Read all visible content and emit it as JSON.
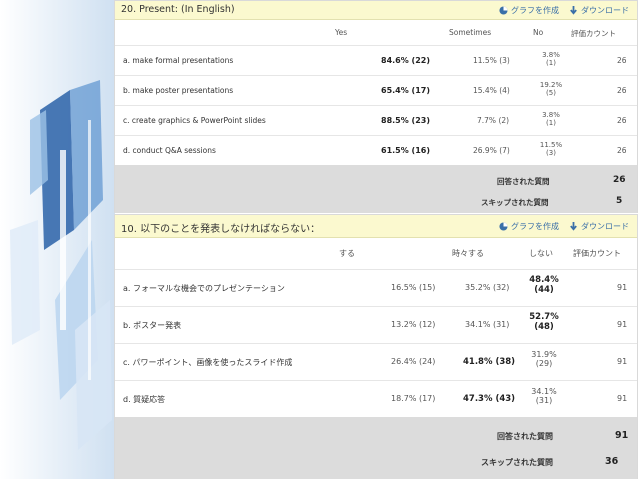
{
  "survey1": {
    "title": "20. Present: (In English)",
    "chart_button": "グラフを作成",
    "download_button": "ダウンロード",
    "columns": [
      "Yes",
      "Sometimes",
      "No",
      "評価カウント"
    ],
    "rows": [
      {
        "label": "a. make formal presentations",
        "yes": "84.6% (22)",
        "sometimes": "11.5% (3)",
        "no_pct": "3.8%",
        "no_n": "(1)",
        "count": "26"
      },
      {
        "label": "b. make poster presentations",
        "yes": "65.4% (17)",
        "sometimes": "15.4% (4)",
        "no_pct": "19.2%",
        "no_n": "(5)",
        "count": "26"
      },
      {
        "label": "c. create graphics & PowerPoint slides",
        "yes": "88.5% (23)",
        "sometimes": "7.7% (2)",
        "no_pct": "3.8%",
        "no_n": "(1)",
        "count": "26"
      },
      {
        "label": "d. conduct Q&A sessions",
        "yes": "61.5% (16)",
        "sometimes": "26.9% (7)",
        "no_pct": "11.5%",
        "no_n": "(3)",
        "count": "26"
      }
    ],
    "answered_label": "回答された質問",
    "answered_value": "26",
    "skipped_label": "スキップされた質問",
    "skipped_value": "5"
  },
  "survey2": {
    "title": "10. 以下のことを発表しなければならない：",
    "chart_button": "グラフを作成",
    "download_button": "ダウンロード",
    "columns": [
      "する",
      "時々する",
      "しない",
      "評価カウント"
    ],
    "rows": [
      {
        "label": "a. フォーマルな機会でのプレゼンテーション",
        "c1": "16.5% (15)",
        "c2": "35.2% (32)",
        "c3_pct": "48.4%",
        "c3_n": "(44)",
        "count": "91"
      },
      {
        "label": "b. ポスター発表",
        "c1": "13.2% (12)",
        "c2": "34.1% (31)",
        "c3_pct": "52.7%",
        "c3_n": "(48)",
        "count": "91"
      },
      {
        "label": "c. パワーポイント、画像を使ったスライド作成",
        "c1": "26.4% (24)",
        "c2": "41.8% (38)",
        "c3_pct": "31.9%",
        "c3_n": "(29)",
        "count": "91"
      },
      {
        "label": "d. 質疑応答",
        "c1": "18.7% (17)",
        "c2": "47.3% (43)",
        "c3_pct": "34.1%",
        "c3_n": "(31)",
        "count": "91"
      }
    ],
    "answered_label": "回答された質問",
    "answered_value": "91",
    "skipped_label": "スキップされた質問",
    "skipped_value": "36"
  },
  "colors": {
    "header_bg": "#fbf9cf",
    "link": "#3a6fa8",
    "footer_bg": "#dcdcdc",
    "art_blue": "#1f4f8f"
  },
  "icons": {
    "chart": "pie-chart-icon",
    "download": "download-arrow-icon"
  }
}
